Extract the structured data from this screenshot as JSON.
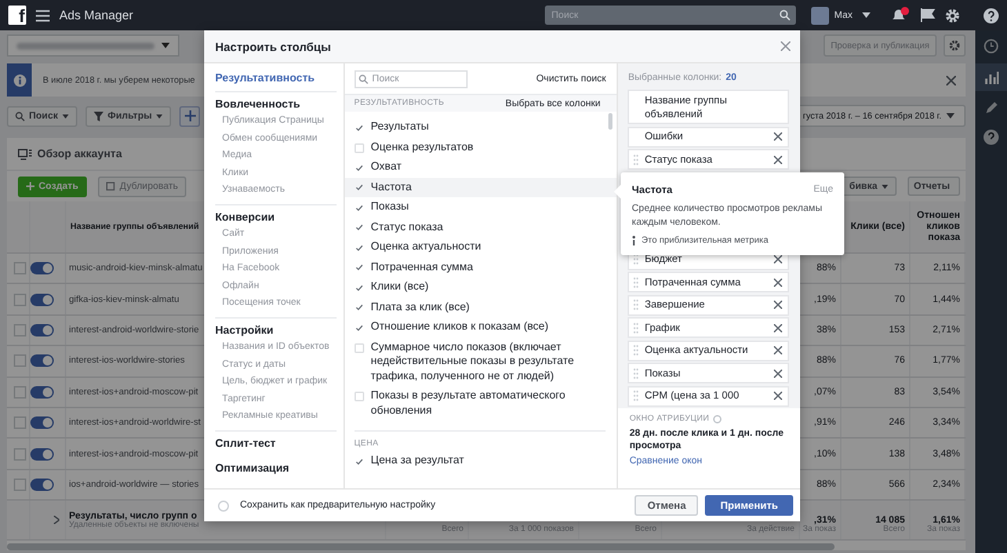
{
  "top_bar": {
    "logo": "f",
    "title": "Ads Manager",
    "search": {
      "placeholder": "Поиск"
    },
    "user": "Max"
  },
  "page": {
    "review_button": "Проверка и публикация",
    "info_banner": "В июле 2018 г. мы уберем некоторые",
    "search_button": "Поиск",
    "filters_button": "Фильтры",
    "date_range": "густа 2018 г. – 16 сентября 2018 г.",
    "card_title": "Обзор аккаунта",
    "create_button": "Создать",
    "duplicate_button": {
      "label": "Дублировать",
      "disabled": true
    },
    "breakdown_button": "бивка",
    "reports_button": "Отчеты"
  },
  "table": {
    "header": {
      "name": "Название группы объявлений",
      "clicks": "Клики (все)",
      "ratio": "Отношен кликов показа"
    },
    "rows": [
      {
        "checked": false,
        "on": true,
        "name": "music-android-kiev-minsk-almatu",
        "column_7": "88%",
        "clicks": "73",
        "ratio": "2,11%"
      },
      {
        "checked": false,
        "on": true,
        "name": "gifka-ios-kiev-minsk-almatu",
        "column_7": ",19%",
        "clicks": "70",
        "ratio": "1,44%"
      },
      {
        "checked": false,
        "on": true,
        "name": "interest-android-worldwire-storie",
        "column_7": "38%",
        "clicks": "153",
        "ratio": "2,71%"
      },
      {
        "checked": false,
        "on": true,
        "name": "interest-ios-worldwire-stories",
        "column_7": "88%",
        "clicks": "76",
        "ratio": "1,77%"
      },
      {
        "checked": false,
        "on": true,
        "name": "interest-ios+android-moscow-pit",
        "column_7": ",07%",
        "clicks": "83",
        "ratio": "3,54%"
      },
      {
        "checked": false,
        "on": true,
        "name": "interest-ios+android-worldwire-st",
        "column_7": ",91%",
        "clicks": "246",
        "ratio": "3,34%"
      },
      {
        "checked": false,
        "on": true,
        "name": "interest-ios+android-moscow-pit",
        "column_7": ",10%",
        "clicks": "138",
        "ratio": "3,48%"
      },
      {
        "checked": false,
        "on": true,
        "name": "ios+android-worldwire — stories",
        "column_7": "88%",
        "clicks": "566",
        "ratio": "2,34%"
      }
    ],
    "footer": {
      "title": "Результаты, число групп о",
      "subtitle": "Удаленные объекты не включены",
      "cells": [
        {
          "caption": "Всего"
        },
        {
          "caption": "За 1 000 показов"
        },
        {
          "caption": "Всего"
        },
        {
          "caption": "За действие"
        },
        {
          "value": ",31%",
          "caption": "За показ"
        },
        {
          "value": "14 085",
          "caption": "Всего"
        },
        {
          "value": "1,61%",
          "caption": "За показ"
        }
      ]
    }
  },
  "dialog": {
    "title": "Настроить столбцы",
    "nav": [
      {
        "label": "Результативность",
        "selected": true
      },
      {
        "label": "Вовлеченность",
        "selected": false,
        "items": [
          {
            "label": "Публикация Страницы",
            "selected": false
          },
          {
            "label": "Обмен сообщениями",
            "selected": false
          },
          {
            "label": "Медиа",
            "selected": false
          },
          {
            "label": "Клики",
            "selected": false
          },
          {
            "label": "Узнаваемость",
            "selected": false
          }
        ]
      },
      {
        "label": "Конверсии",
        "selected": false,
        "items": [
          {
            "label": "Сайт",
            "selected": false
          },
          {
            "label": "Приложения",
            "selected": false
          },
          {
            "label": "На Facebook",
            "selected": false
          },
          {
            "label": "Офлайн",
            "selected": false
          },
          {
            "label": "Посещения точек",
            "selected": false
          }
        ]
      },
      {
        "label": "Настройки",
        "selected": false,
        "items": [
          {
            "label": "Названия и ID объектов",
            "selected": false
          },
          {
            "label": "Статус и даты",
            "selected": false
          },
          {
            "label": "Цель, бюджет и график",
            "selected": false
          },
          {
            "label": "Таргетинг",
            "selected": false
          },
          {
            "label": "Рекламные креативы",
            "selected": false
          }
        ]
      },
      {
        "label": "Сплит-тест",
        "selected": false
      },
      {
        "label": "Оптимизация",
        "selected": false
      }
    ],
    "search": {
      "placeholder": "Поиск"
    },
    "clear_search": "Очистить поиск",
    "section": "РЕЗУЛЬТАТИВНОСТЬ",
    "select_all": "Выбрать все колонки",
    "metrics": [
      {
        "label": "Результаты",
        "checked": true,
        "selected": false
      },
      {
        "label": "Оценка результатов",
        "checked": false,
        "selected": false
      },
      {
        "label": "Охват",
        "checked": true,
        "selected": false
      },
      {
        "label": "Частота",
        "checked": true,
        "selected": true
      },
      {
        "label": "Показы",
        "checked": true,
        "selected": false
      },
      {
        "label": "Статус показа",
        "checked": true,
        "selected": false
      },
      {
        "label": "Оценка актуальности",
        "checked": true,
        "selected": false
      },
      {
        "label": "Потраченная сумма",
        "checked": true,
        "selected": false
      },
      {
        "label": "Клики (все)",
        "checked": true,
        "selected": false
      },
      {
        "label": "Плата за клик (все)",
        "checked": true,
        "selected": false
      },
      {
        "label": "Отношение кликов к показам (все)",
        "checked": true,
        "selected": false
      },
      {
        "label": "Суммарное число показов (включает недействительные показы в результате трафика, полученного не от людей)",
        "checked": false,
        "selected": false
      },
      {
        "label": "Показы в результате автоматического обновления",
        "checked": false,
        "selected": false
      }
    ],
    "price_section": "ЦЕНА",
    "price_metrics": [
      {
        "label": "Цена за результат",
        "checked": true,
        "selected": false
      }
    ],
    "selected_columns": {
      "label": "Выбранные колонки:",
      "count": "20",
      "items": [
        {
          "label": "Название группы объявлений",
          "removable": false,
          "draggable": false
        },
        {
          "label": "Ошибки",
          "removable": true,
          "draggable": false
        },
        {
          "label": "Статус показа",
          "removable": true,
          "draggable": true
        },
        {
          "label": "Бюджет",
          "removable": true,
          "draggable": true
        },
        {
          "label": "Потраченная сумма",
          "removable": true,
          "draggable": true
        },
        {
          "label": "Завершение",
          "removable": true,
          "draggable": true
        },
        {
          "label": "График",
          "removable": true,
          "draggable": true
        },
        {
          "label": "Оценка актуальности",
          "removable": true,
          "draggable": true
        },
        {
          "label": "Показы",
          "removable": true,
          "draggable": true
        },
        {
          "label": "CPM (цена за 1 000",
          "removable": true,
          "draggable": true
        }
      ]
    },
    "attribution": {
      "title": "ОКНО АТРИБУЦИИ",
      "value": "28 дн. после клика и 1 дн. после просмотра",
      "link": "Сравнение окон"
    },
    "save_preset": {
      "label": "Сохранить как предварительную настройку",
      "checked": false
    },
    "buttons": {
      "cancel": "Отмена",
      "apply": "Применить"
    },
    "tooltip": {
      "title": "Частота",
      "more": "Еще",
      "description": "Среднее количество просмотров рекламы каждым человеком.",
      "note": "Это приблизительная метрика"
    }
  }
}
